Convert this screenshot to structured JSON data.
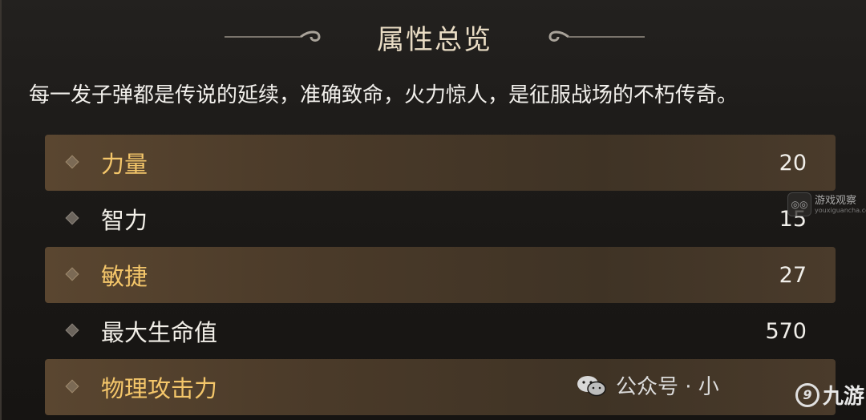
{
  "panel": {
    "title": "属性总览",
    "description": "每一发子弹都是传说的延续，准确致命，火力惊人，是征服战场的不朽传奇。"
  },
  "stats": [
    {
      "label": "力量",
      "value": "20",
      "highlighted": true
    },
    {
      "label": "智力",
      "value": "15",
      "highlighted": false
    },
    {
      "label": "敏捷",
      "value": "27",
      "highlighted": true
    },
    {
      "label": "最大生命值",
      "value": "570",
      "highlighted": false
    },
    {
      "label": "物理攻击力",
      "value": "",
      "highlighted": true
    }
  ],
  "watermarks": {
    "site": {
      "main": "游戏观察",
      "sub": "youxiguancha.com",
      "icon": "glasses-icon"
    },
    "wechat": {
      "text": "公众号 · 小",
      "icon": "wechat-icon"
    },
    "brand": {
      "text": "九游",
      "icon": "jiuyou-logo-icon"
    }
  },
  "colors": {
    "highlight_label": "#f4c66a",
    "normal_label": "#f2efe8",
    "title": "#e9dcc4",
    "row_highlight": "#4a3a29"
  }
}
